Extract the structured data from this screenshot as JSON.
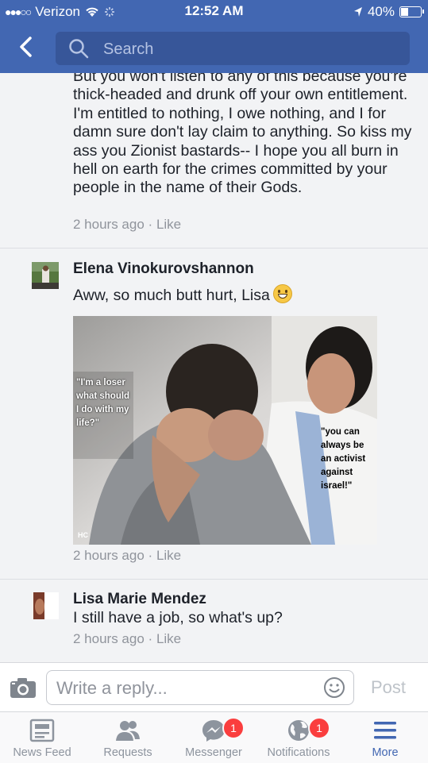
{
  "status_bar": {
    "carrier": "Verizon",
    "time": "12:52 AM",
    "battery": "40%"
  },
  "nav": {
    "search_placeholder": "Search"
  },
  "comments": [
    {
      "text": "But you won't listen to any of this because you're thick-headed and drunk off your own entitlement. I'm entitled to nothing, I owe nothing, and I for damn sure don't lay claim to anything. So kiss my ass you Zionist bastards-- I hope you all burn in hell on earth for the crimes committed by your people in the name of their Gods.",
      "time": "2 hours ago",
      "like": "Like"
    },
    {
      "author": "Elena Vinokurovshannon",
      "text": "Aww, so much butt hurt, Lisa",
      "time": "2 hours ago",
      "like": "Like",
      "image_captions": {
        "left": "\"I'm a loser what should I do with my life?\"",
        "right": "\"you can always be an activist against israel!\"",
        "corner": "HC"
      }
    },
    {
      "author": "Lisa Marie Mendez",
      "text": "I still have a job, so what's up?",
      "time": "2 hours ago",
      "like": "Like"
    }
  ],
  "meta_separator": "·",
  "reply": {
    "placeholder": "Write a reply...",
    "post_label": "Post"
  },
  "tabs": [
    {
      "label": "News Feed",
      "icon": "news-feed-icon"
    },
    {
      "label": "Requests",
      "icon": "friend-requests-icon"
    },
    {
      "label": "Messenger",
      "icon": "messenger-icon",
      "badge": "1"
    },
    {
      "label": "Notifications",
      "icon": "globe-icon",
      "badge": "1"
    },
    {
      "label": "More",
      "icon": "menu-icon",
      "active": true
    }
  ],
  "colors": {
    "brand": "#4267b2",
    "meta": "#90949c",
    "badge": "#fa3e3e"
  }
}
